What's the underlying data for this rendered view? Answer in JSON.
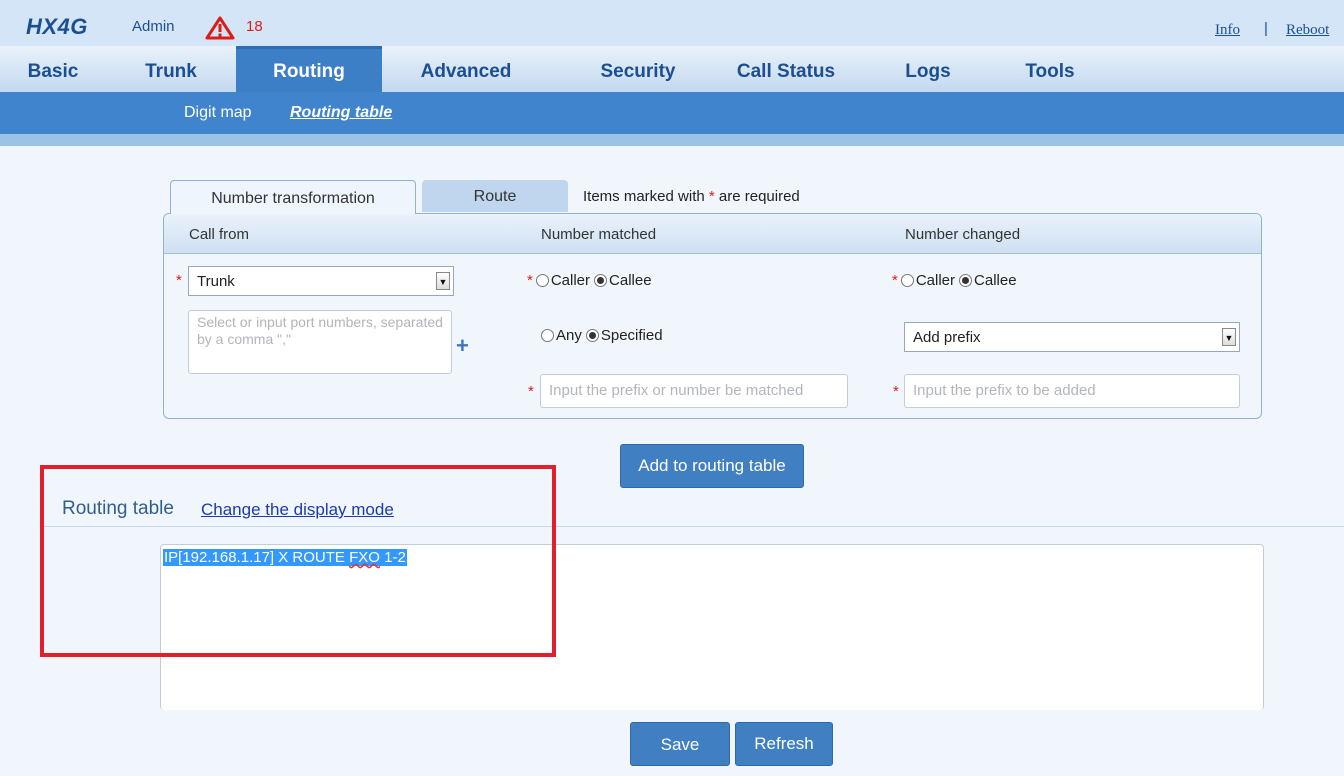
{
  "header": {
    "brand": "HX4G",
    "user": "Admin",
    "alert_count": "18",
    "info_label": "Info",
    "separator": "|",
    "reboot_label": "Reboot"
  },
  "nav": {
    "tabs": [
      {
        "label": "Basic"
      },
      {
        "label": "Trunk"
      },
      {
        "label": "Routing",
        "active": true
      },
      {
        "label": "Advanced"
      },
      {
        "label": "Security"
      },
      {
        "label": "Call Status"
      },
      {
        "label": "Logs"
      },
      {
        "label": "Tools"
      }
    ]
  },
  "subnav": {
    "items": [
      {
        "label": "Digit map"
      },
      {
        "label": "Routing table",
        "active": true
      }
    ]
  },
  "form": {
    "tabs": [
      {
        "label": "Number transformation",
        "active": true
      },
      {
        "label": "Route"
      }
    ],
    "required_prefix": "Items marked with",
    "required_star": "*",
    "required_suffix": "are required",
    "columns": {
      "call_from": "Call from",
      "number_matched": "Number matched",
      "number_changed": "Number changed"
    },
    "call_from_select": "Trunk",
    "port_placeholder": "Select or input port numbers, separated by a comma \",\"",
    "matched_caller": "Caller",
    "matched_callee": "Callee",
    "matched_any": "Any",
    "matched_specified": "Specified",
    "matched_placeholder": "Input the prefix or number be matched",
    "changed_caller": "Caller",
    "changed_callee": "Callee",
    "changed_select": "Add prefix",
    "changed_placeholder": "Input the prefix to be added",
    "add_button": "Add to routing table"
  },
  "routing_table": {
    "title": "Routing table",
    "change_mode_link": "Change the display mode",
    "entry_prefix": "IP[192.168.1.17] X ROUTE ",
    "entry_squiggle": "FXO",
    "entry_suffix": " 1-2"
  },
  "footer": {
    "save_label": "Save",
    "refresh_label": "Refresh"
  },
  "colors": {
    "brand_blue": "#1c4f91",
    "active_tab": "#3d7fc6",
    "button": "#3f7fc2",
    "alert_red": "#d91e18",
    "highlight_red": "#e0202c"
  }
}
